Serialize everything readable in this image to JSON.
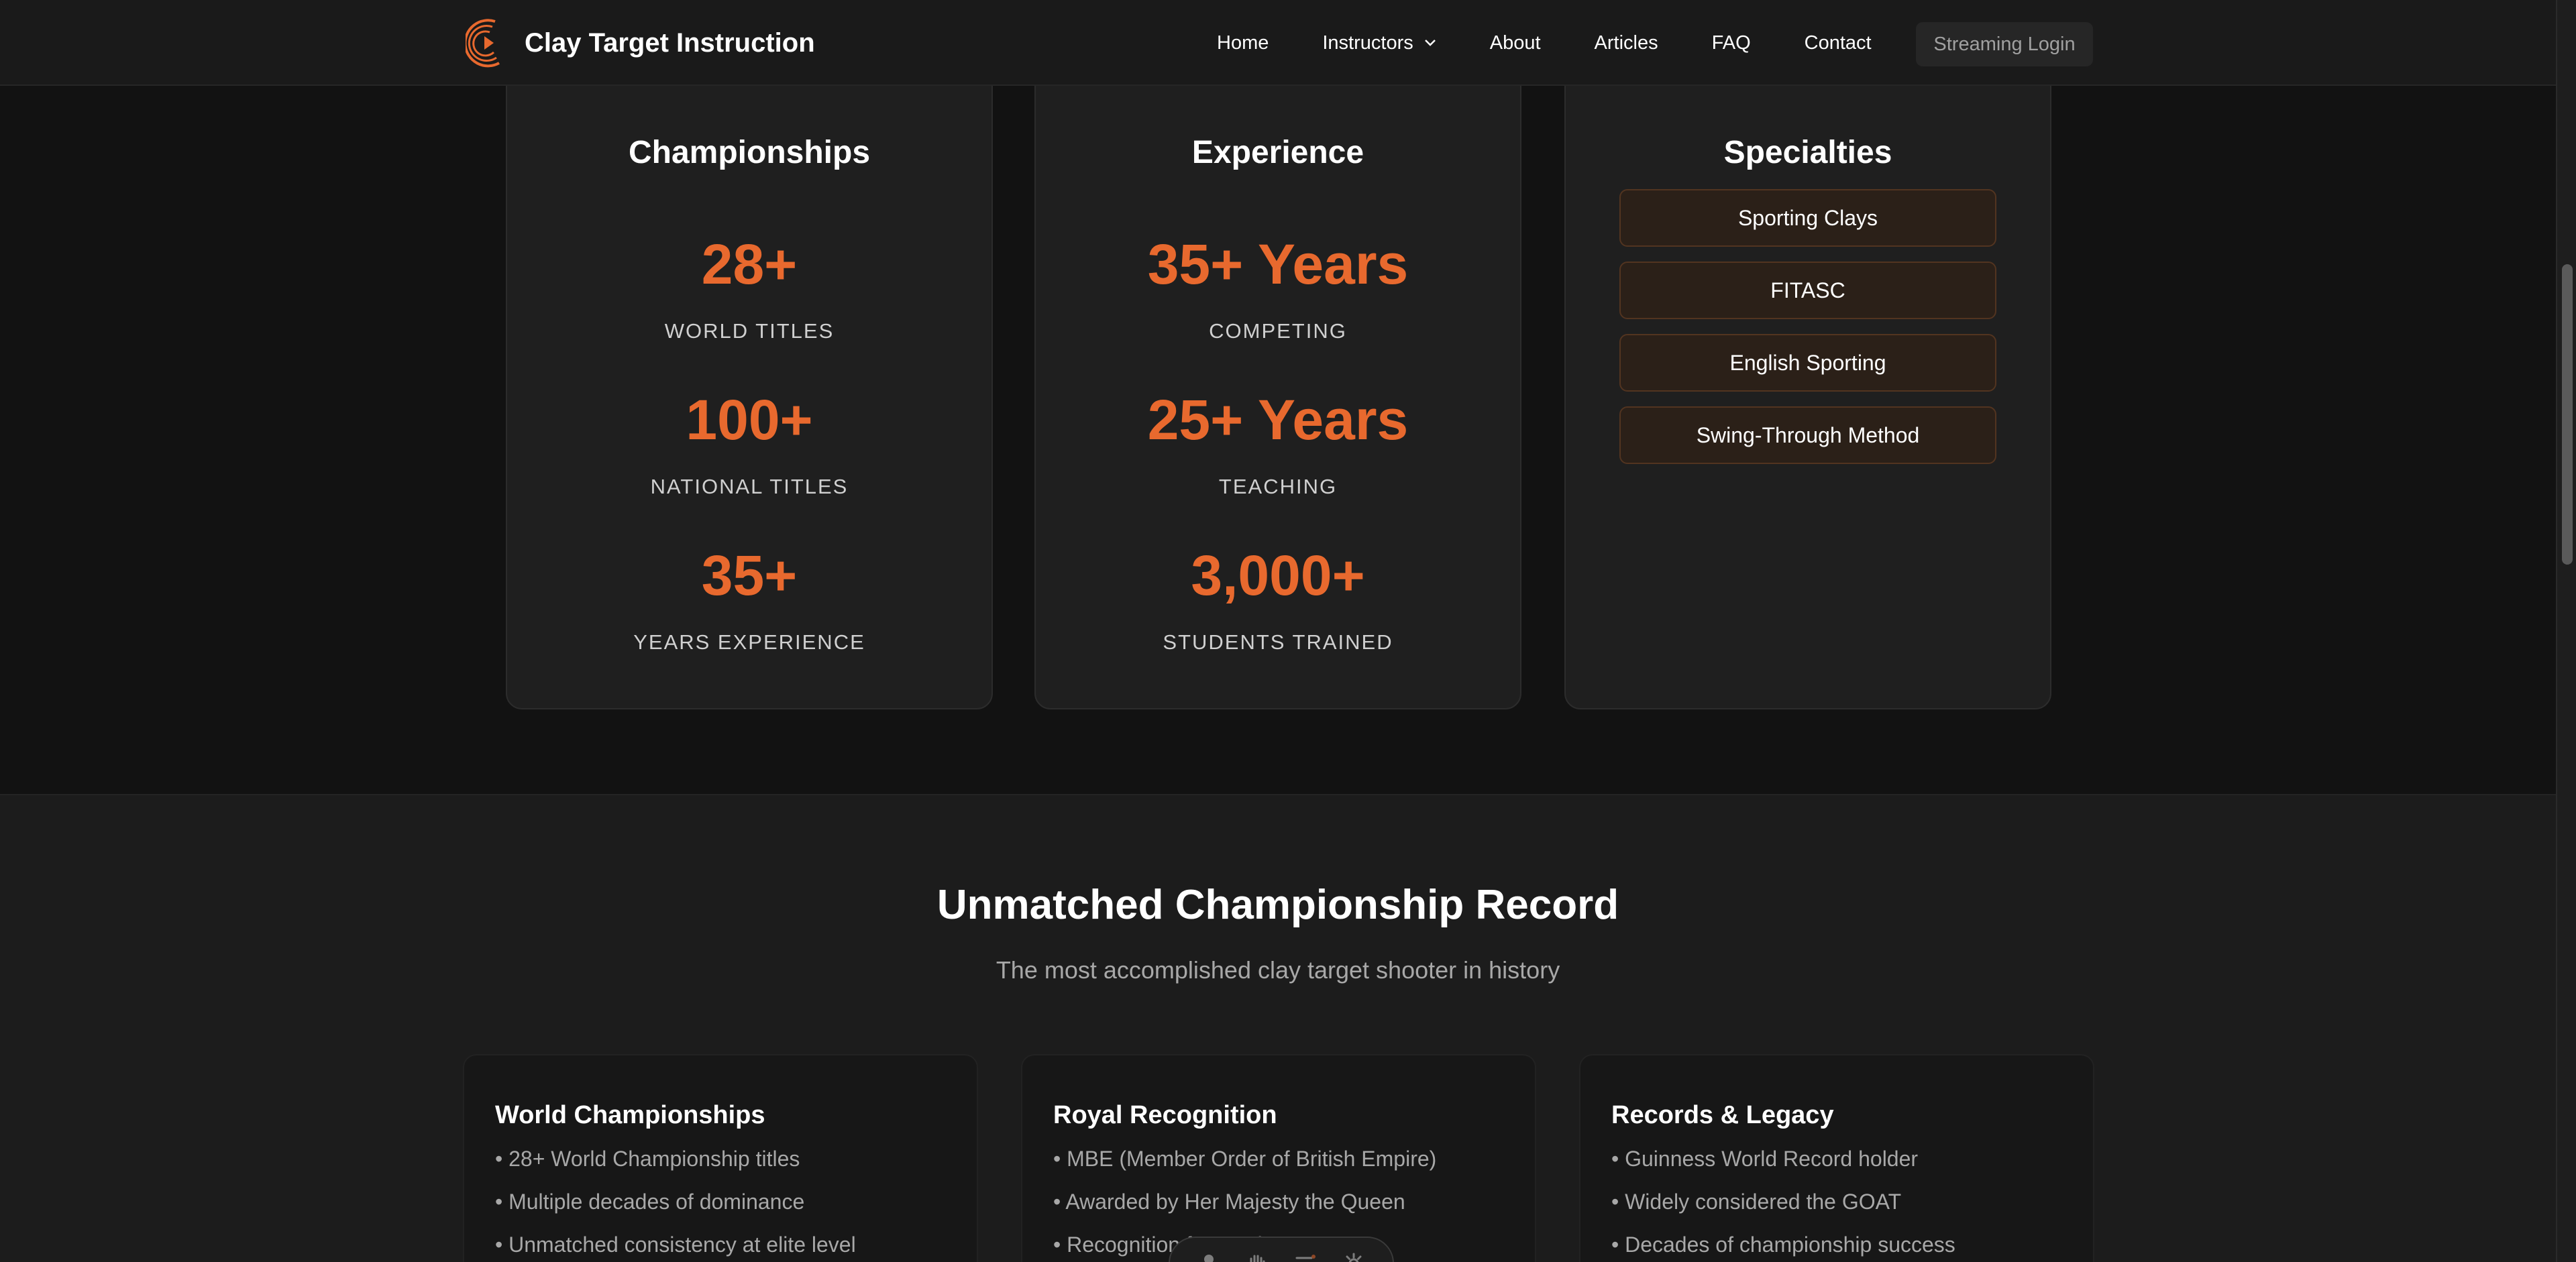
{
  "nav": {
    "brand": "Clay Target Instruction",
    "links": [
      "Home",
      "Instructors",
      "About",
      "Articles",
      "FAQ",
      "Contact"
    ],
    "streaming_login": "Streaming Login"
  },
  "stats": {
    "championships": {
      "title": "Championships",
      "items": [
        {
          "value": "28+",
          "label": "WORLD TITLES"
        },
        {
          "value": "100+",
          "label": "NATIONAL TITLES"
        },
        {
          "value": "35+",
          "label": "YEARS EXPERIENCE"
        }
      ]
    },
    "experience": {
      "title": "Experience",
      "items": [
        {
          "value": "35+ Years",
          "label": "COMPETING"
        },
        {
          "value": "25+ Years",
          "label": "TEACHING"
        },
        {
          "value": "3,000+",
          "label": "STUDENTS TRAINED"
        }
      ]
    },
    "specialties": {
      "title": "Specialties",
      "items": [
        "Sporting Clays",
        "FITASC",
        "English Sporting",
        "Swing-Through Method"
      ]
    }
  },
  "record": {
    "title": "Unmatched Championship Record",
    "subtitle": "The most accomplished clay target shooter in history",
    "cards": [
      {
        "title": "World Championships",
        "items": [
          "• 28+ World Championship titles",
          "• Multiple decades of dominance",
          "• Unmatched consistency at elite level"
        ]
      },
      {
        "title": "Royal Recognition",
        "items": [
          "• MBE (Member Order of British Empire)",
          "• Awarded by Her Majesty the Queen",
          "• Recognition for services to sport"
        ]
      },
      {
        "title": "Records & Legacy",
        "items": [
          "• Guinness World Record holder",
          "• Widely considered the GOAT",
          "• Decades of championship success"
        ]
      }
    ]
  },
  "colors": {
    "accent": "#e8692e",
    "background": "#121212",
    "card": "#1f1f1f"
  },
  "icons": [
    "logo-icon",
    "chevron-down-icon",
    "user-icon",
    "hand-icon",
    "list-icon",
    "gear-icon"
  ]
}
